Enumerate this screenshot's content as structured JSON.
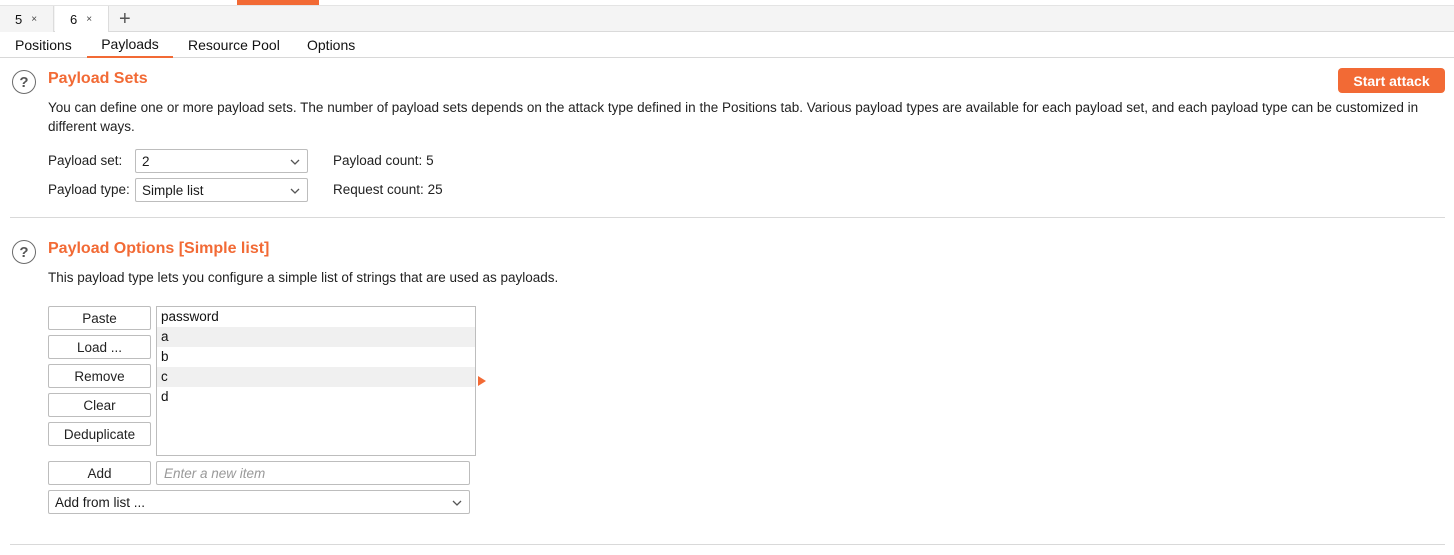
{
  "attack_tabs": [
    {
      "num": "5",
      "close": "×"
    },
    {
      "num": "6",
      "close": "×"
    }
  ],
  "attack_tab_add": "+",
  "sub_tabs": [
    "Positions",
    "Payloads",
    "Resource Pool",
    "Options"
  ],
  "active_sub_tab": "Payloads",
  "payload_sets": {
    "help_icon": "?",
    "title": "Payload Sets",
    "description": "You can define one or more payload sets. The number of payload sets depends on the attack type defined in the Positions tab. Various payload types are available for each payload set, and each payload type can be customized in different ways.",
    "start_attack_label": "Start attack",
    "payload_set_label": "Payload set:",
    "payload_set_value": "2",
    "payload_type_label": "Payload type:",
    "payload_type_value": "Simple list",
    "payload_count_label": "Payload count:",
    "payload_count_value": "5",
    "request_count_label": "Request count:",
    "request_count_value": "25"
  },
  "payload_options": {
    "help_icon": "?",
    "title": "Payload Options [Simple list]",
    "description": "This payload type lets you configure a simple list of strings that are used as payloads.",
    "buttons": {
      "paste": "Paste",
      "load": "Load ...",
      "remove": "Remove",
      "clear": "Clear",
      "deduplicate": "Deduplicate",
      "add": "Add"
    },
    "items": [
      "password",
      "a",
      "b",
      "c",
      "d"
    ],
    "new_item_placeholder": "Enter a new item",
    "add_from_list_label": "Add from list ..."
  },
  "colors": {
    "accent": "#f26a35"
  }
}
